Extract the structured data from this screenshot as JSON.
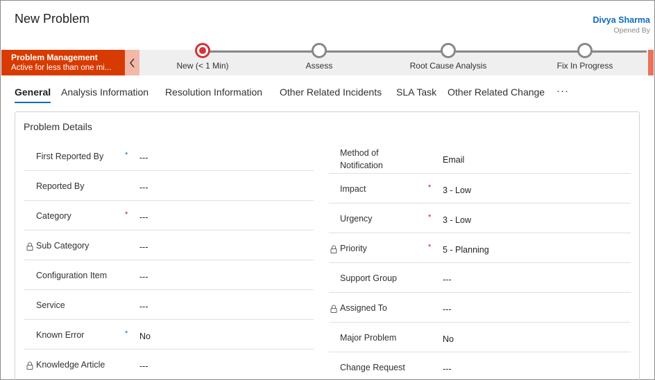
{
  "header": {
    "title": "New Problem",
    "owner_name": "Divya Sharma",
    "owner_role": "Opened By"
  },
  "process": {
    "active_stage_name": "Problem Management",
    "active_stage_status": "Active for less than one mi...",
    "stages": [
      {
        "label": "New  (< 1 Min)",
        "current": true
      },
      {
        "label": "Assess",
        "current": false
      },
      {
        "label": "Root Cause Analysis",
        "current": false
      },
      {
        "label": "Fix In Progress",
        "current": false
      }
    ]
  },
  "tabs": [
    {
      "label": "General",
      "active": true
    },
    {
      "label": "Analysis Information",
      "active": false
    },
    {
      "label": "Resolution Information",
      "active": false
    },
    {
      "label": "Other Related Incidents",
      "active": false
    },
    {
      "label": "SLA Task",
      "active": false
    },
    {
      "label": "Other Related Change",
      "active": false
    }
  ],
  "more_tabs": "···",
  "section": {
    "title": "Problem Details",
    "left_fields": [
      {
        "label": "First Reported By",
        "required": "blue",
        "locked": false,
        "value": "---"
      },
      {
        "label": "Reported By",
        "required": "",
        "locked": false,
        "value": "---"
      },
      {
        "label": "Category",
        "required": "red",
        "locked": false,
        "value": "---"
      },
      {
        "label": "Sub Category",
        "required": "",
        "locked": true,
        "value": "---"
      },
      {
        "label": "Configuration Item",
        "required": "",
        "locked": false,
        "value": "---"
      },
      {
        "label": "Service",
        "required": "",
        "locked": false,
        "value": "---"
      },
      {
        "label": "Known Error",
        "required": "blue",
        "locked": false,
        "value": "No"
      },
      {
        "label": "Knowledge Article",
        "required": "",
        "locked": true,
        "value": "---"
      }
    ],
    "right_fields": [
      {
        "label": "Method of Notification",
        "required": "",
        "locked": false,
        "value": "Email"
      },
      {
        "label": "Impact",
        "required": "red",
        "locked": false,
        "value": "3 - Low"
      },
      {
        "label": "Urgency",
        "required": "red",
        "locked": false,
        "value": "3 - Low"
      },
      {
        "label": "Priority",
        "required": "red",
        "locked": true,
        "value": "5 - Planning"
      },
      {
        "label": "Support Group",
        "required": "",
        "locked": false,
        "value": "---"
      },
      {
        "label": "Assigned To",
        "required": "",
        "locked": true,
        "value": "---"
      },
      {
        "label": "Major Problem",
        "required": "",
        "locked": false,
        "value": "No"
      },
      {
        "label": "Change Request",
        "required": "",
        "locked": false,
        "value": "---"
      }
    ]
  }
}
